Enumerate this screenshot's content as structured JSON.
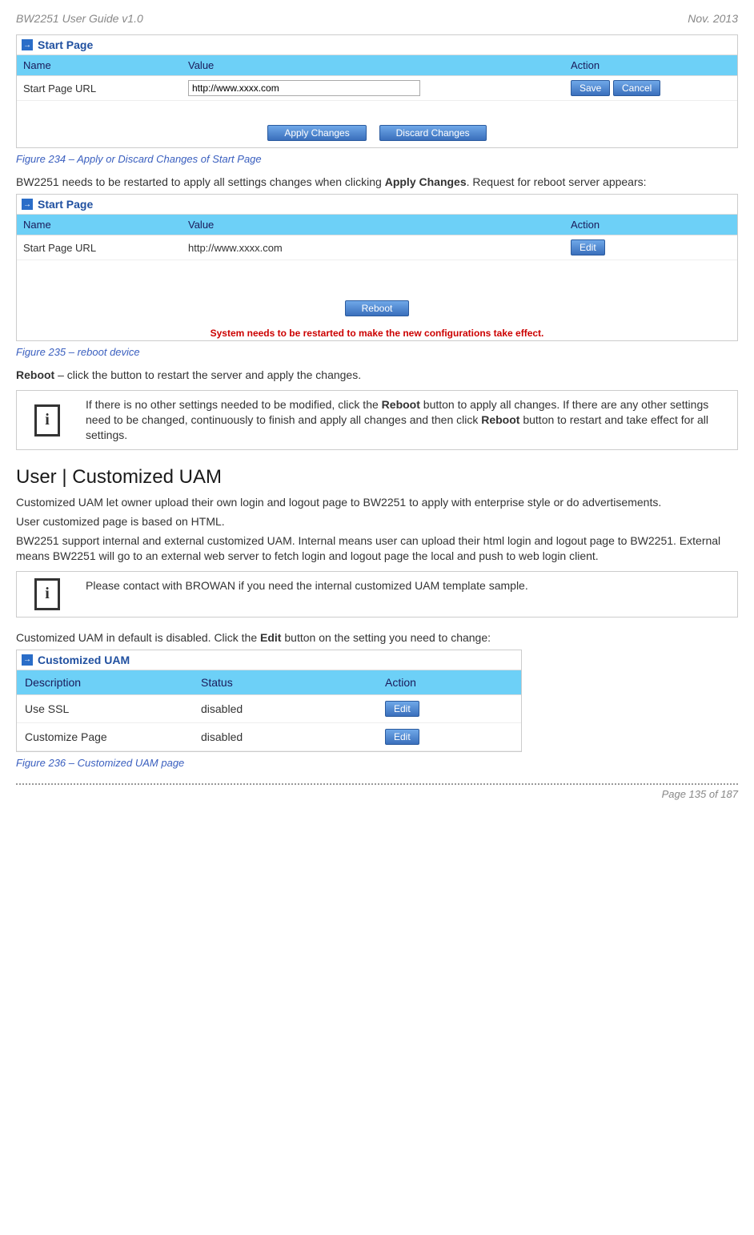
{
  "header": {
    "left": "BW2251 User Guide v1.0",
    "right": "Nov.  2013"
  },
  "fig234": {
    "panelTitle": "Start Page",
    "cols": {
      "name": "Name",
      "value": "Value",
      "action": "Action"
    },
    "rowLabel": "Start Page URL",
    "inputValue": "http://www.xxxx.com",
    "saveBtn": "Save",
    "cancelBtn": "Cancel",
    "applyBtn": "Apply Changes",
    "discardBtn": "Discard Changes",
    "caption": "Figure 234 – Apply or Discard Changes of Start Page"
  },
  "para1a": "BW2251 needs to be restarted to apply all settings changes when clicking ",
  "para1b": "Apply Changes",
  "para1c": ". Request for reboot server appears:",
  "fig235": {
    "panelTitle": "Start Page",
    "cols": {
      "name": "Name",
      "value": "Value",
      "action": "Action"
    },
    "rowLabel": "Start Page URL",
    "rowValue": "http://www.xxxx.com",
    "editBtn": "Edit",
    "rebootBtn": "Reboot",
    "redMsg": "System needs to be restarted to make the new configurations take effect.",
    "caption": "Figure 235 – reboot device"
  },
  "rebootLine": {
    "bold": "Reboot",
    "rest": " – click the button to restart the server and apply the changes."
  },
  "info1": {
    "t1": "If there is no other settings needed to be modified, click the ",
    "b1": "Reboot",
    "t2": " button to apply all changes. If there are any other settings need to be changed, continuously to finish and apply all changes and then click ",
    "b2": "Reboot",
    "t3": " button to restart and take effect  for all settings."
  },
  "sectionTitle": "User | Customized UAM",
  "p2": "Customized UAM let owner upload their own login and logout page to BW2251 to apply with enterprise style or do advertisements.",
  "p3": "User customized page is based on HTML.",
  "p4": "BW2251 support internal and external customized UAM. Internal means user can upload their html login and logout page to BW2251. External means BW2251 will go to an external web server to fetch login and logout page the local and push to web login client.",
  "info2": "Please contact with BROWAN if you need the internal customized UAM template sample.",
  "p5a": "Customized UAM in default is disabled.  Click the ",
  "p5b": "Edit",
  "p5c": " button on the setting you need to change:",
  "fig236": {
    "panelTitle": "Customized UAM",
    "cols": {
      "desc": "Description",
      "status": "Status",
      "action": "Action"
    },
    "rows": [
      {
        "desc": "Use SSL",
        "status": "disabled",
        "btn": "Edit"
      },
      {
        "desc": "Customize Page",
        "status": "disabled",
        "btn": "Edit"
      }
    ],
    "caption": "Figure 236 – Customized UAM page"
  },
  "footer": "Page 135 of 187"
}
